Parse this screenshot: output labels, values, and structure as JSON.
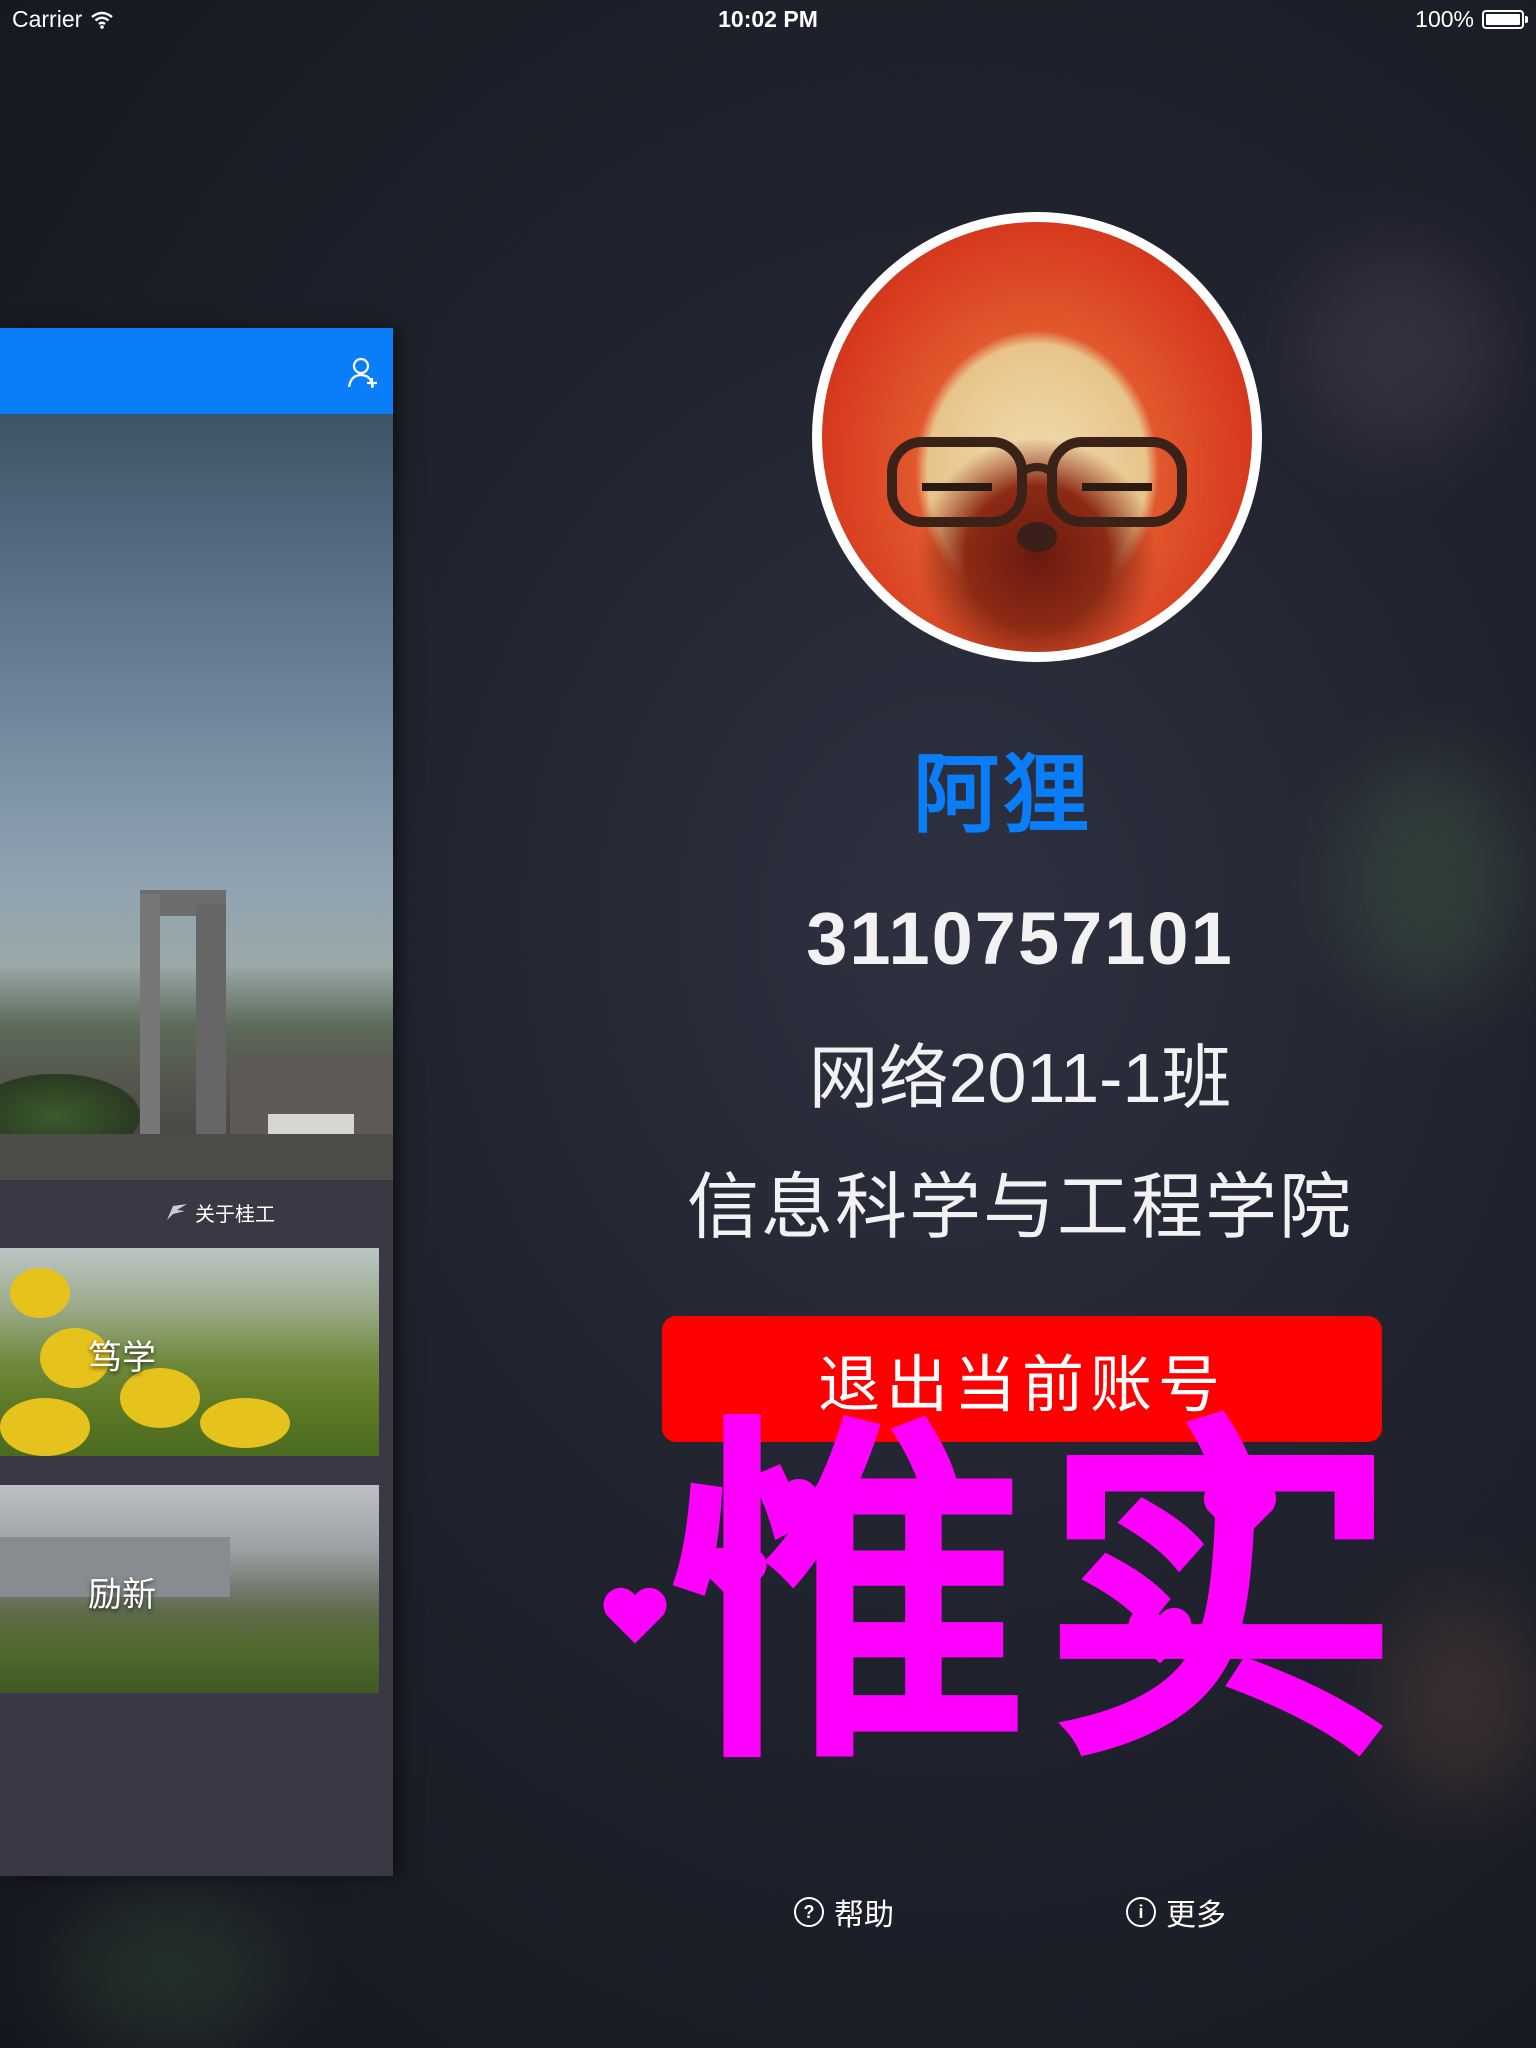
{
  "status_bar": {
    "carrier": "Carrier",
    "time": "10:02 PM",
    "battery": "100%",
    "battery_level": 1.0
  },
  "side_panel": {
    "about_label": "关于桂工",
    "tiles": [
      {
        "label": "笃学"
      },
      {
        "label": "励新"
      }
    ]
  },
  "profile": {
    "name": "阿狸",
    "student_id": "3110757101",
    "class": "网络2011-1班",
    "college": "信息科学与工程学院",
    "logout_label": "退出当前账号",
    "motto": "惟实"
  },
  "footer": {
    "help_label": "帮助",
    "more_label": "更多"
  },
  "colors": {
    "accent_blue": "#0a7df8",
    "logout_red": "#fe0000",
    "motto_magenta": "#ff00ff"
  },
  "icons": [
    "wifi-icon",
    "battery-icon",
    "add-user-icon",
    "about-logo-icon",
    "help-icon",
    "info-icon"
  ]
}
